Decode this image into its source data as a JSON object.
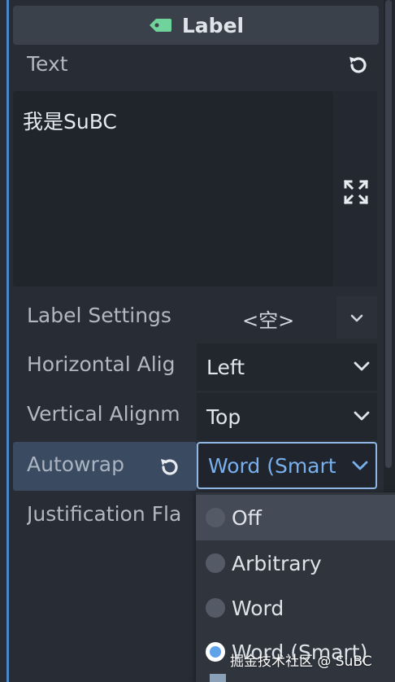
{
  "header": {
    "title": "Label",
    "icon": "tag-icon",
    "icon_color": "#6fd39b"
  },
  "text_property": {
    "label": "Text",
    "value": "我是SuBC",
    "revert_icon": "revert-icon",
    "expand_icon": "expand-icon"
  },
  "properties": {
    "label_settings": {
      "label": "Label Settings",
      "value": "<空>"
    },
    "horizontal_alignment": {
      "label": "Horizontal Alig",
      "value": "Left"
    },
    "vertical_alignment": {
      "label": "Vertical Alignm",
      "value": "Top"
    },
    "autowrap": {
      "label": "Autowrap",
      "value": "Word (Smart"
    },
    "justification_flags": {
      "label": "Justification Fla"
    }
  },
  "autowrap_menu": {
    "options": [
      "Off",
      "Arbitrary",
      "Word",
      "Word (Smart)"
    ],
    "selected_index": 3,
    "hover_index": 0
  },
  "watermark": "掘金技术社区 @ SuBC",
  "colors": {
    "accent": "#78b0ee",
    "background": "#272c35",
    "highlight_row": "#3a4a60"
  }
}
